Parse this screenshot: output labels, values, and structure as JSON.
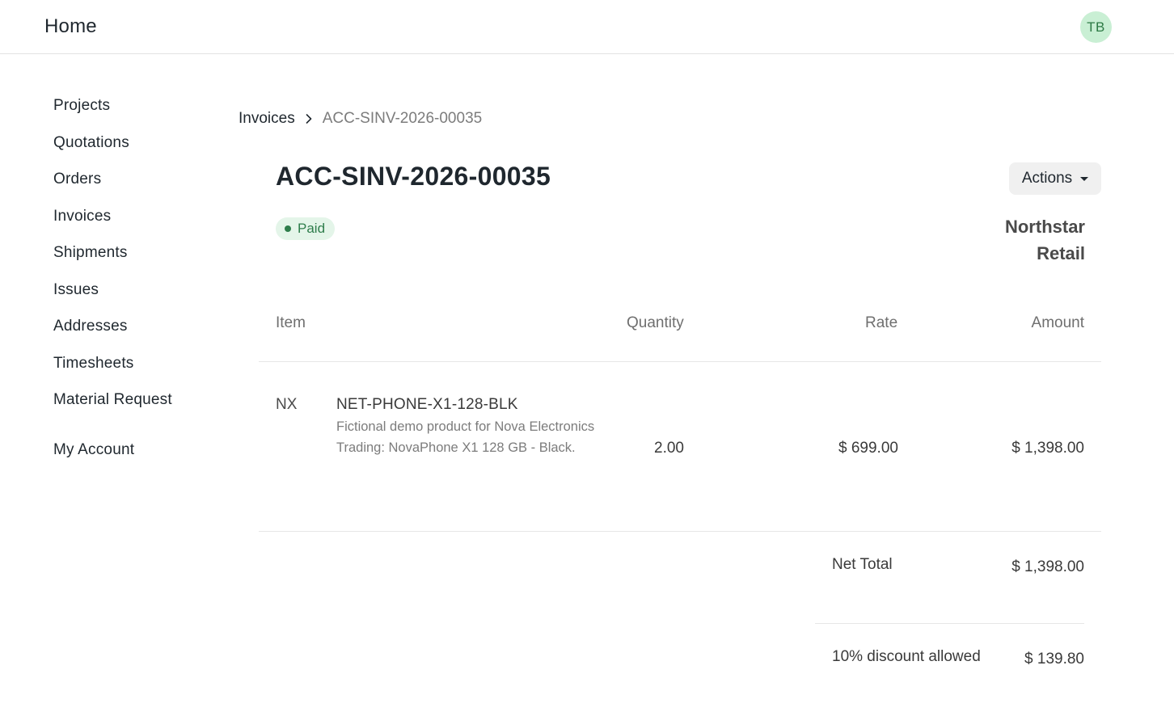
{
  "header": {
    "home_label": "Home",
    "avatar_initials": "TB"
  },
  "sidebar": {
    "items": [
      {
        "label": "Projects"
      },
      {
        "label": "Quotations"
      },
      {
        "label": "Orders"
      },
      {
        "label": "Invoices"
      },
      {
        "label": "Shipments"
      },
      {
        "label": "Issues"
      },
      {
        "label": "Addresses"
      },
      {
        "label": "Timesheets"
      },
      {
        "label": "Material Request"
      }
    ],
    "account_label": "My Account"
  },
  "breadcrumb": {
    "parent": "Invoices",
    "current": "ACC-SINV-2026-00035"
  },
  "invoice": {
    "title": "ACC-SINV-2026-00035",
    "status": "Paid",
    "actions_label": "Actions",
    "company": "Northstar Retail"
  },
  "table": {
    "headers": {
      "item": "Item",
      "quantity": "Quantity",
      "rate": "Rate",
      "amount": "Amount"
    },
    "rows": [
      {
        "thumb": "NX",
        "code": "NET-PHONE-X1-128-BLK",
        "description": "Fictional demo product for Nova Electronics Trading: NovaPhone X1 128 GB - Black.",
        "quantity": "2.00",
        "rate": "$ 699.00",
        "amount": "$ 1,398.00"
      }
    ]
  },
  "totals": [
    {
      "label": "Net Total",
      "value": "$ 1,398.00"
    },
    {
      "label": "10% discount allowed",
      "value": "$ 139.80"
    }
  ],
  "colors": {
    "avatar_bg": "#c9efd4",
    "status_bg": "#e4f5e9",
    "status_fg": "#2e7d4b"
  }
}
